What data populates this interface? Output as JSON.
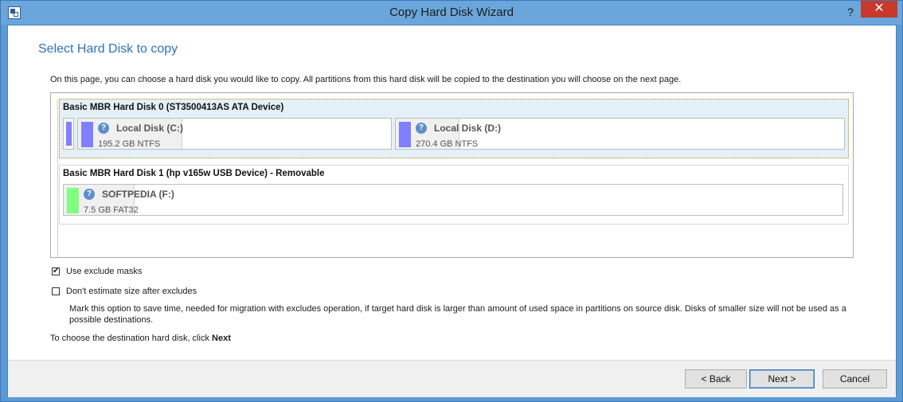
{
  "window": {
    "title": "Copy Hard Disk Wizard",
    "help_glyph": "?",
    "close_glyph": "✕"
  },
  "page": {
    "title": "Select Hard Disk to copy",
    "intro": "On this page, you can choose a hard disk you would like to copy. All partitions from this hard disk will be copied to the destination you will choose on the next page."
  },
  "disks": [
    {
      "title": "Basic MBR Hard Disk 0 (ST3500413AS ATA Device)",
      "selected": true,
      "partitions": [
        {
          "name": "Local Disk (C:)",
          "info": "195.2 GB NTFS",
          "color": "#7f7fff",
          "used_fraction": 0.33
        },
        {
          "name": "Local Disk (D:)",
          "info": "270.4 GB NTFS",
          "color": "#7f7fff",
          "used_fraction": 0.14
        }
      ]
    },
    {
      "title": "Basic MBR Hard Disk 1 (hp v165w USB Device) - Removable",
      "selected": false,
      "partitions": [
        {
          "name": "SOFTPEDIA (F:)",
          "info": "7.5 GB FAT32",
          "color": "#80ff80",
          "used_fraction": 0.09
        }
      ]
    }
  ],
  "options": {
    "use_exclude_masks": {
      "label": "Use exclude masks",
      "checked": true,
      "check_glyph": "✔"
    },
    "dont_estimate": {
      "label": "Don't estimate size after excludes",
      "checked": false
    },
    "note": "Mark this option to save time, needed for migration with excludes operation, if target hard disk is larger than amount of used space in partitions on source disk. Disks of smaller size will not be used as a possible destinations."
  },
  "next_hint": {
    "prefix": "To choose the destination hard disk, click ",
    "bold": "Next"
  },
  "buttons": {
    "back": "< Back",
    "next": "Next >",
    "cancel": "Cancel"
  },
  "colors": {
    "title_blue": "#2f72b6",
    "partition_blue": "#7f7fff",
    "partition_green": "#80ff80",
    "selection_bg": "#e4f0f7"
  }
}
